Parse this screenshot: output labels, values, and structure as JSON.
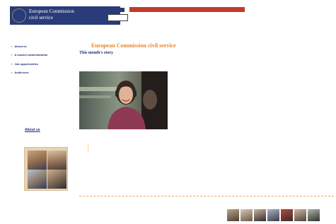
{
  "header": {
    "logo_line1": "European Commission",
    "logo_line2": "civil service",
    "skip_text": "",
    "search_placeholder": "",
    "top_bar_text": "",
    "languages": [
      "",
      "",
      "",
      "",
      "",
      ""
    ]
  },
  "sidebar": {
    "items": [
      {
        "label": "About us"
      },
      {
        "label": "A modern administration"
      },
      {
        "label": "Job opportunities"
      },
      {
        "label": "Audiences"
      }
    ],
    "text_block_1": "",
    "text_block_2": "",
    "text_block_3": "",
    "about_link": "About us"
  },
  "main": {
    "title": "European Commission civil service",
    "story_heading": "This month's story",
    "intro": "",
    "after_photo": "",
    "links": [
      "",
      ""
    ]
  },
  "colors": {
    "banner": "#2a3b7a",
    "top_bar": "#c23a2c",
    "accent_orange": "#e8852a",
    "nav_blue": "#1f2f7a"
  },
  "icons": {
    "logo": "eu-flag-icon",
    "nav_bullet": "square-bullet-icon",
    "link_bullet": "square-bullet-icon"
  }
}
